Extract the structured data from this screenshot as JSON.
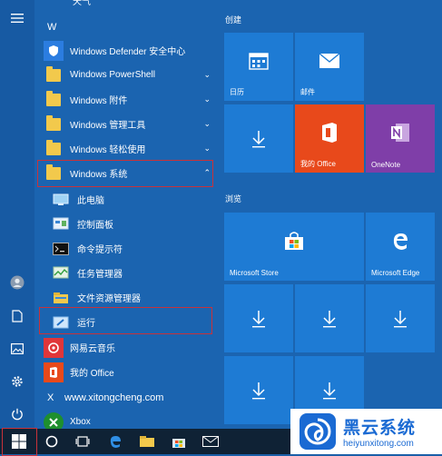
{
  "list": {
    "top_partial": "天气",
    "letter_w": "W",
    "letter_x": "X",
    "items": [
      {
        "label": "Windows Defender 安全中心"
      },
      {
        "label": "Windows PowerShell"
      },
      {
        "label": "Windows 附件"
      },
      {
        "label": "Windows 管理工具"
      },
      {
        "label": "Windows 轻松使用"
      },
      {
        "label": "Windows 系统"
      },
      {
        "label": "此电脑"
      },
      {
        "label": "控制面板"
      },
      {
        "label": "命令提示符"
      },
      {
        "label": "任务管理器"
      },
      {
        "label": "文件资源管理器"
      },
      {
        "label": "运行"
      },
      {
        "label": "网易云音乐"
      },
      {
        "label": "我的 Office"
      },
      {
        "label": "www.xitongcheng.com"
      },
      {
        "label": "Xbox"
      }
    ]
  },
  "tiles": {
    "group1_title": "创建",
    "group2_title": "浏览",
    "calendar": "日历",
    "mail": "邮件",
    "my_office": "我的 Office",
    "onenote": "OneNote",
    "store": "Microsoft Store",
    "edge": "Microsoft Edge"
  },
  "watermark": {
    "title": "黑云系统",
    "url": "heiyunxitong.com"
  },
  "colors": {
    "tile": "#1e7bd4",
    "office": "#e8491b",
    "onenote": "#7f3ea8",
    "highlight": "#c8323a"
  }
}
